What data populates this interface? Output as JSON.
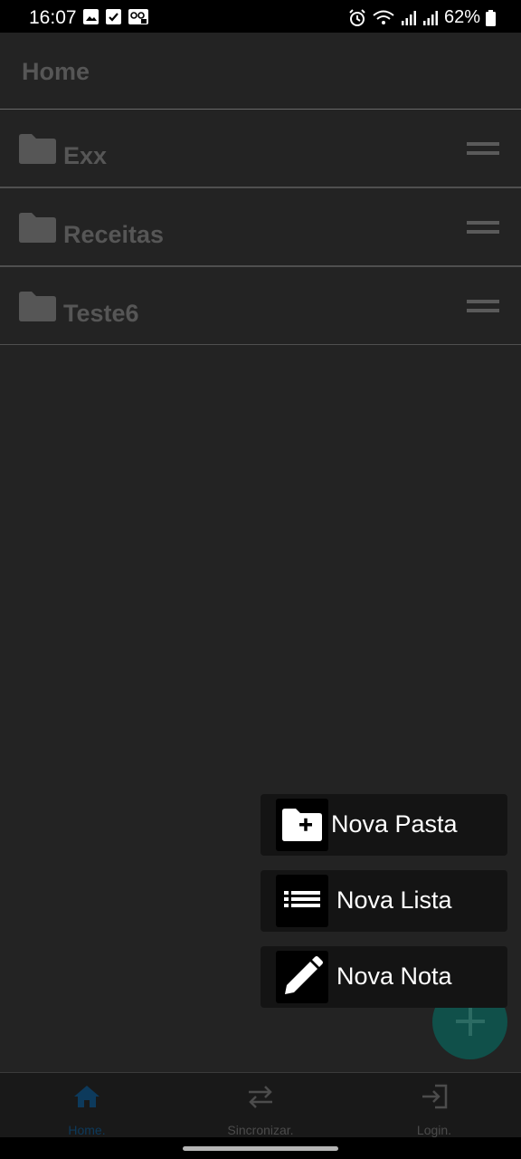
{
  "status_bar": {
    "time": "16:07",
    "battery": "62%",
    "icons": [
      "image-icon",
      "check-icon",
      "voicemail-icon",
      "alarm-icon",
      "wifi-icon",
      "signal-icon",
      "signal-icon",
      "battery-icon"
    ]
  },
  "header": {
    "title": "Home"
  },
  "folders": [
    {
      "name": "Exx"
    },
    {
      "name": "Receitas"
    },
    {
      "name": "Teste6"
    }
  ],
  "fab_menu": {
    "new_folder": "Nova Pasta",
    "new_list": "Nova Lista",
    "new_note": "Nova Nota"
  },
  "bottom_nav": {
    "home": "Home.",
    "sync": "Sincronizar.",
    "login": "Login."
  },
  "colors": {
    "background": "#232323",
    "accent_active": "#0d3a5c",
    "fab": "#10504a",
    "menu_item": "#141414"
  }
}
